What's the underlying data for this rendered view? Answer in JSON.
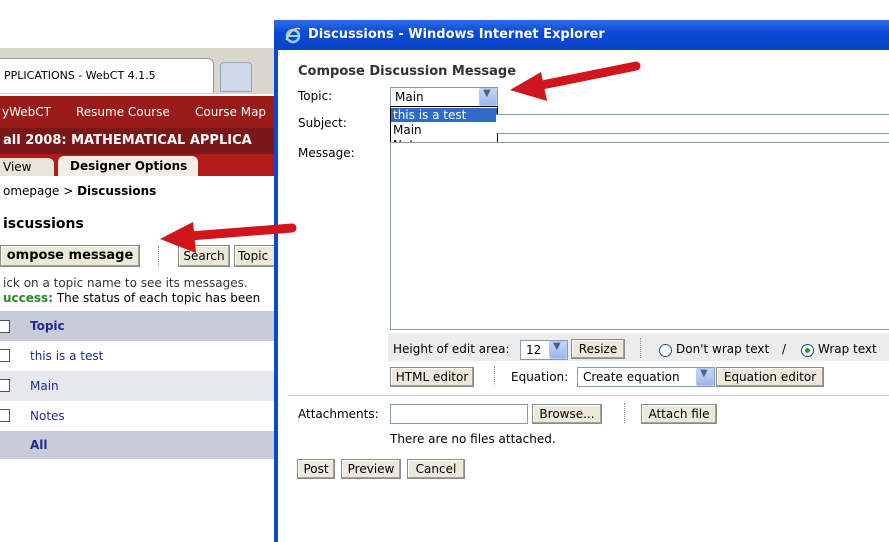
{
  "background_window": {
    "tab_title": "PPLICATIONS - WebCT 4.1.5",
    "nav_links": [
      "yWebCT",
      "Resume Course",
      "Course Map"
    ],
    "course_title": "all 2008: MATHEMATICAL APPLICA",
    "tabs": [
      "View",
      "Designer Options"
    ],
    "breadcrumb_prefix": "omepage > ",
    "breadcrumb_current": "Discussions",
    "heading": "iscussions",
    "toolbar": {
      "compose_label": "ompose message",
      "search_label": "Search",
      "topic_label": "Topic"
    },
    "info_line": "ick on a topic name to see its messages.",
    "success_label": "uccess:",
    "success_text": " The status of each topic has been",
    "table": {
      "header": "Topic",
      "rows": [
        "this is a test",
        "Main",
        "Notes"
      ],
      "footer": "All"
    }
  },
  "popup": {
    "window_title": "Discussions - Windows Internet Explorer",
    "heading": "Compose Discussion Message",
    "topic_label": "Topic:",
    "topic_selected": "Main",
    "topic_options": [
      "this is a test",
      "Main",
      "Notes"
    ],
    "subject_label": "Subject:",
    "subject_value": "",
    "message_label": "Message:",
    "message_value": "",
    "height_label": "Height of edit area:",
    "height_value": "12",
    "resize_label": "Resize",
    "dont_wrap_label": "Don't wrap text",
    "wrap_separator": "/",
    "wrap_label": "Wrap text",
    "wrap_selected": "Wrap text",
    "html_editor_label": "HTML editor",
    "equation_label": "Equation:",
    "equation_selected": "Create equation",
    "equation_editor_label": "Equation editor",
    "attachments_label": "Attachments:",
    "attachment_value": "",
    "browse_label": "Browse...",
    "attach_label": "Attach file",
    "no_files_text": "There are no files attached.",
    "post_label": "Post",
    "preview_label": "Preview",
    "cancel_label": "Cancel"
  },
  "colors": {
    "nav_bar": "#9b1b1b",
    "title_bar": "#0b4bd6",
    "arrow": "#d0161c",
    "selection": "#316ac5",
    "success": "#2a8a2a",
    "link": "#1f2a8a"
  },
  "icons": [
    "ie-logo-icon",
    "chevron-down-icon",
    "arrow-annotation-icon"
  ]
}
